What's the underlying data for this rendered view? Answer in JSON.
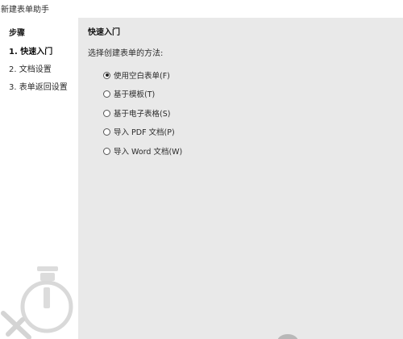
{
  "window": {
    "title": "新建表单助手"
  },
  "sidebar": {
    "heading": "步骤",
    "items": [
      {
        "label": "1. 快速入门",
        "active": true
      },
      {
        "label": "2. 文档设置",
        "active": false
      },
      {
        "label": "3. 表单返回设置",
        "active": false
      }
    ]
  },
  "main": {
    "title": "快速入门",
    "prompt": "选择创建表单的方法:",
    "options": [
      {
        "label": "使用空白表单(F)",
        "selected": true
      },
      {
        "label": "基于模板(T)",
        "selected": false
      },
      {
        "label": "基于电子表格(S)",
        "selected": false
      },
      {
        "label": "导入 PDF 文档(P)",
        "selected": false
      },
      {
        "label": "导入 Word 文档(W)",
        "selected": false
      }
    ]
  }
}
